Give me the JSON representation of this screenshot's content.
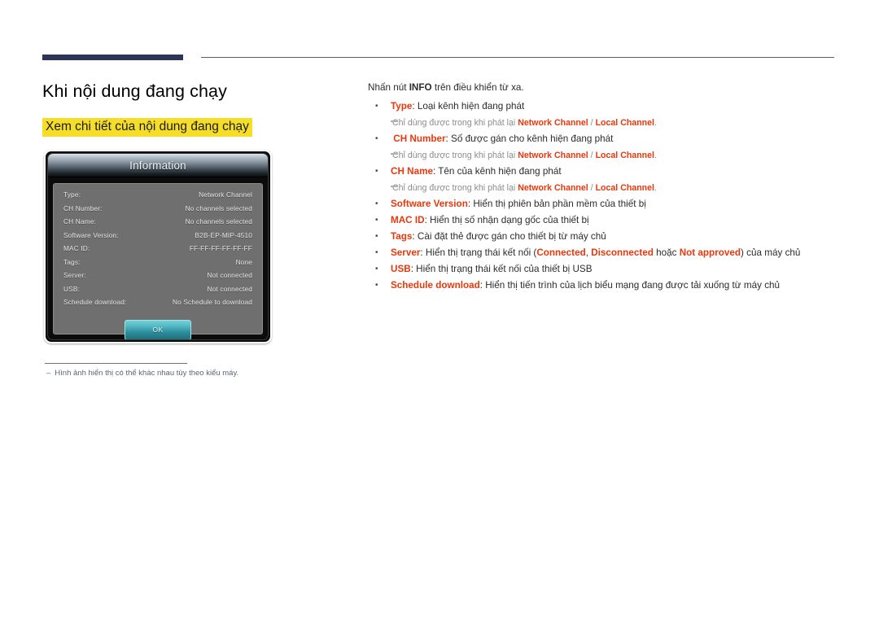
{
  "header": {
    "rule_thick_color": "#2d3456",
    "rule_thin_color": "#5a5c78"
  },
  "left": {
    "page_title": "Khi nội dung đang chạy",
    "sub_title": "Xem chi tiết của nội dung đang chạy",
    "highlight_color": "#f5dd28",
    "footnote_dash": "–",
    "footnote": "Hình ảnh hiển thị có thể khác nhau tùy theo kiểu máy."
  },
  "dialog": {
    "title": "Information",
    "rows": [
      {
        "label": "Type:",
        "value": "Network Channel"
      },
      {
        "label": "CH Number:",
        "value": "No channels selected"
      },
      {
        "label": "CH Name:",
        "value": "No channels selected"
      },
      {
        "label": "Software Version:",
        "value": "B2B-EP-MIP-4510"
      },
      {
        "label": "MAC ID:",
        "value": "FF-FF-FF-FF-FF-FF"
      },
      {
        "label": "Tags:",
        "value": "None"
      },
      {
        "label": "Server:",
        "value": "Not connected"
      },
      {
        "label": "USB:",
        "value": "Not connected"
      },
      {
        "label": "Schedule download:",
        "value": "No Schedule to download"
      }
    ],
    "ok_label": "OK",
    "accent_color": "#2e8e9c"
  },
  "right": {
    "intro_before": "Nhấn nút ",
    "intro_bold": "INFO",
    "intro_after": " trên điều khiển từ xa.",
    "accent_color": "#e8380d",
    "items": [
      {
        "term": "Type",
        "desc": ": Loại kênh hiện đang phát",
        "note": {
          "before": "Chỉ dùng được trong khi phát lại ",
          "term1": "Network Channel",
          "sep": " / ",
          "term2": "Local Channel",
          "after": "."
        }
      },
      {
        "term": "CH Number",
        "desc": ": Số được gán cho kênh hiện đang phát",
        "note": {
          "before": "Chỉ dùng được trong khi phát lại ",
          "term1": "Network Channel",
          "sep": " / ",
          "term2": "Local Channel",
          "after": "."
        }
      },
      {
        "term": "CH Name",
        "desc": ": Tên của kênh hiện đang phát",
        "note": {
          "before": "Chỉ dùng được trong khi phát lại ",
          "term1": "Network Channel",
          "sep": " / ",
          "term2": "Local Channel",
          "after": "."
        }
      },
      {
        "term": "Software Version",
        "desc": ": Hiển thị phiên bản phần mềm của thiết bị"
      },
      {
        "term": "MAC ID",
        "desc": ": Hiển thị số nhận dạng gốc của thiết bị"
      },
      {
        "term": "Tags",
        "desc": ": Cài đặt thẻ được gán cho thiết bị từ máy chủ"
      },
      {
        "term": "Server",
        "desc_pre": ": Hiển thị trạng thái kết nối (",
        "inline1": "Connected",
        "inline_sep1": ", ",
        "inline2": "Disconnected",
        "inline_sep2": " hoặc ",
        "inline3": "Not approved",
        "desc_post": ") của máy chủ"
      },
      {
        "term": "USB",
        "desc": ": Hiển thị trạng thái kết nối của thiết bị USB"
      },
      {
        "term": "Schedule download",
        "desc": ": Hiển thị tiến trình của lịch biểu mạng đang được tải xuống từ máy chủ"
      }
    ]
  }
}
